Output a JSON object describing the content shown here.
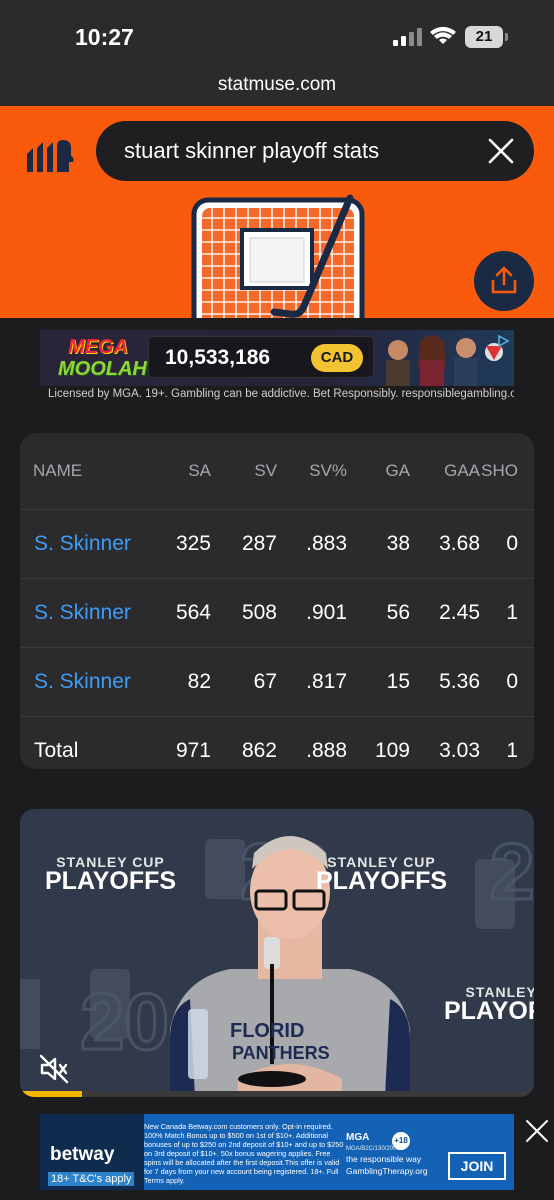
{
  "status_bar": {
    "time": "10:27",
    "battery": "21"
  },
  "browser": {
    "url": "statmuse.com"
  },
  "search": {
    "query": "stuart skinner playoff stats"
  },
  "colors": {
    "brand_orange": "#fa5a0c",
    "link_blue": "#3e9cf7",
    "card_bg": "#2b2b2e"
  },
  "ad_top": {
    "brand_line1": "MEGA",
    "brand_line2": "MOOLAH",
    "jackpot": "10,533,186",
    "currency": "CAD",
    "disclaimer": "Licensed by MGA. 19+. Gambling can be addictive. Bet Responsibly. responsiblegambling.org"
  },
  "stats": {
    "headers": [
      "NAME",
      "SA",
      "SV",
      "SV%",
      "GA",
      "GAA",
      "SHO"
    ],
    "rows": [
      {
        "name": "S. Skinner",
        "sa": "325",
        "sv": "287",
        "svp": ".883",
        "ga": "38",
        "gaa": "3.68",
        "sho": "0"
      },
      {
        "name": "S. Skinner",
        "sa": "564",
        "sv": "508",
        "svp": ".901",
        "ga": "56",
        "gaa": "2.45",
        "sho": "1"
      },
      {
        "name": "S. Skinner",
        "sa": "82",
        "sv": "67",
        "svp": ".817",
        "ga": "15",
        "gaa": "5.36",
        "sho": "0"
      }
    ],
    "total": {
      "label": "Total",
      "sa": "971",
      "sv": "862",
      "svp": ".888",
      "ga": "109",
      "gaa": "3.03",
      "sho": "1"
    }
  },
  "video": {
    "brand_small": "STANLEY CUP",
    "brand_big": "PLAYOFFS",
    "brand_right_small": "STANLEY",
    "brand_right_big": "PLAYOFF",
    "shirt_text_1": "FLORID",
    "shirt_text_2": "PANTHERS",
    "progress": 0.12
  },
  "ad_bottom": {
    "brand": "betway",
    "tc": "18+ T&C's apply",
    "fine_print": "New Canada Betway.com customers only. Opt-in required. 100% Match Bonus up to $500 on 1st of $10+. Additional bonuses of up to $250 on 2nd deposit of $10+ and up to $250 on 3rd deposit of $10+. 50x bonus wagering applies. Free spins will be allocated after the first deposit.This offer is valid for 7 days from your new account being registered. 18+. Full Terms apply.",
    "mga": "MGA",
    "mga_sub": "MGA/B2C/130/2006",
    "age": "+18",
    "resp_line1": "the responsible way",
    "resp_line2": "GamblingTherapy.org",
    "cta": "JOIN"
  }
}
